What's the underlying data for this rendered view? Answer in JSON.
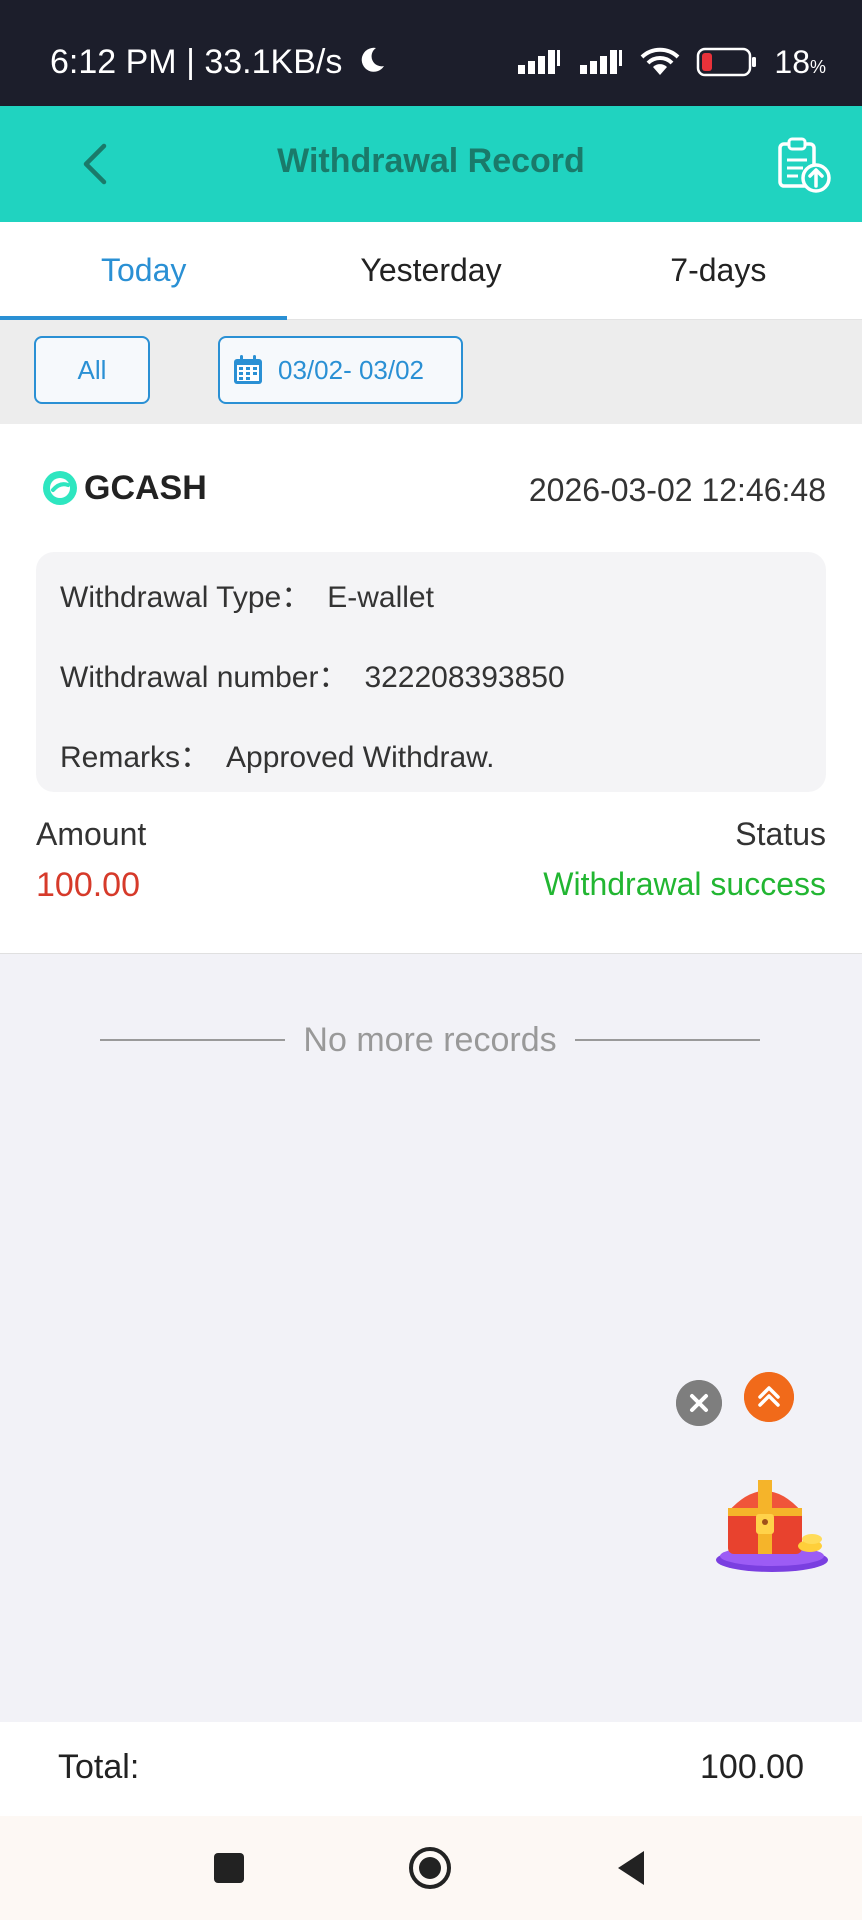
{
  "status_bar": {
    "time_speed": "6:12 PM | 33.1KB/s",
    "battery_percent": "18",
    "battery_unit": "%"
  },
  "header": {
    "title": "Withdrawal Record"
  },
  "tabs": [
    {
      "label": "Today",
      "active": true
    },
    {
      "label": "Yesterday",
      "active": false
    },
    {
      "label": "7-days",
      "active": false
    }
  ],
  "filter": {
    "type_label": "All",
    "date_range": "03/02- 03/02"
  },
  "record": {
    "brand": "GCASH",
    "datetime": "2026-03-02 12:46:48",
    "type_label": "Withdrawal Type：",
    "type_value": "E-wallet",
    "number_label": "Withdrawal number：",
    "number_value": "322208393850",
    "remarks_label": "Remarks：",
    "remarks_value": "Approved Withdraw.",
    "amount_label": "Amount",
    "amount_value": "100.00",
    "status_label": "Status",
    "status_value": "Withdrawal success"
  },
  "list_end": "No more records",
  "total": {
    "label": "Total:",
    "value": "100.00"
  },
  "colors": {
    "header_bg": "#20d3c0",
    "accent": "#2a90d4",
    "amount": "#d63a2a",
    "success": "#22b632"
  }
}
